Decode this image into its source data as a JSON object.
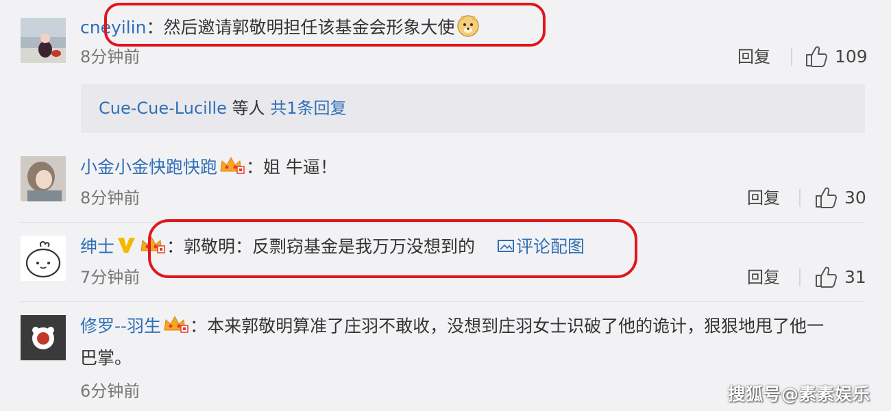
{
  "comments": [
    {
      "username": "cneyilin",
      "text": "然后邀请郭敬明担任该基金会形象大使",
      "time": "8分钟前",
      "reply_label": "回复",
      "likes": "109"
    },
    {
      "username": "小金小金快跑快跑",
      "text": "姐 牛逼！",
      "time": "8分钟前",
      "reply_label": "回复",
      "likes": "30"
    },
    {
      "username": "绅士",
      "text": "郭敬明：反剽窃基金是我万万没想到的",
      "image_link": "评论配图",
      "time": "7分钟前",
      "reply_label": "回复",
      "likes": "31"
    },
    {
      "username": "修罗--羽生",
      "text_line1": "本来郭敬明算准了庄羽不敢收，没想到庄羽女士识破了他的诡计，狠狠地甩了他一",
      "text_line2": "巴掌。",
      "time": "6分钟前"
    }
  ],
  "subreply": {
    "users": "Cue-Cue-Lucille",
    "suffix": "等人",
    "count_link": "共1条回复"
  },
  "separator": "：",
  "watermark": "搜狐号@素素娱乐",
  "colors": {
    "username": "#2f6fb6",
    "highlight": "#e0161d",
    "background": "#f2f2f5"
  }
}
